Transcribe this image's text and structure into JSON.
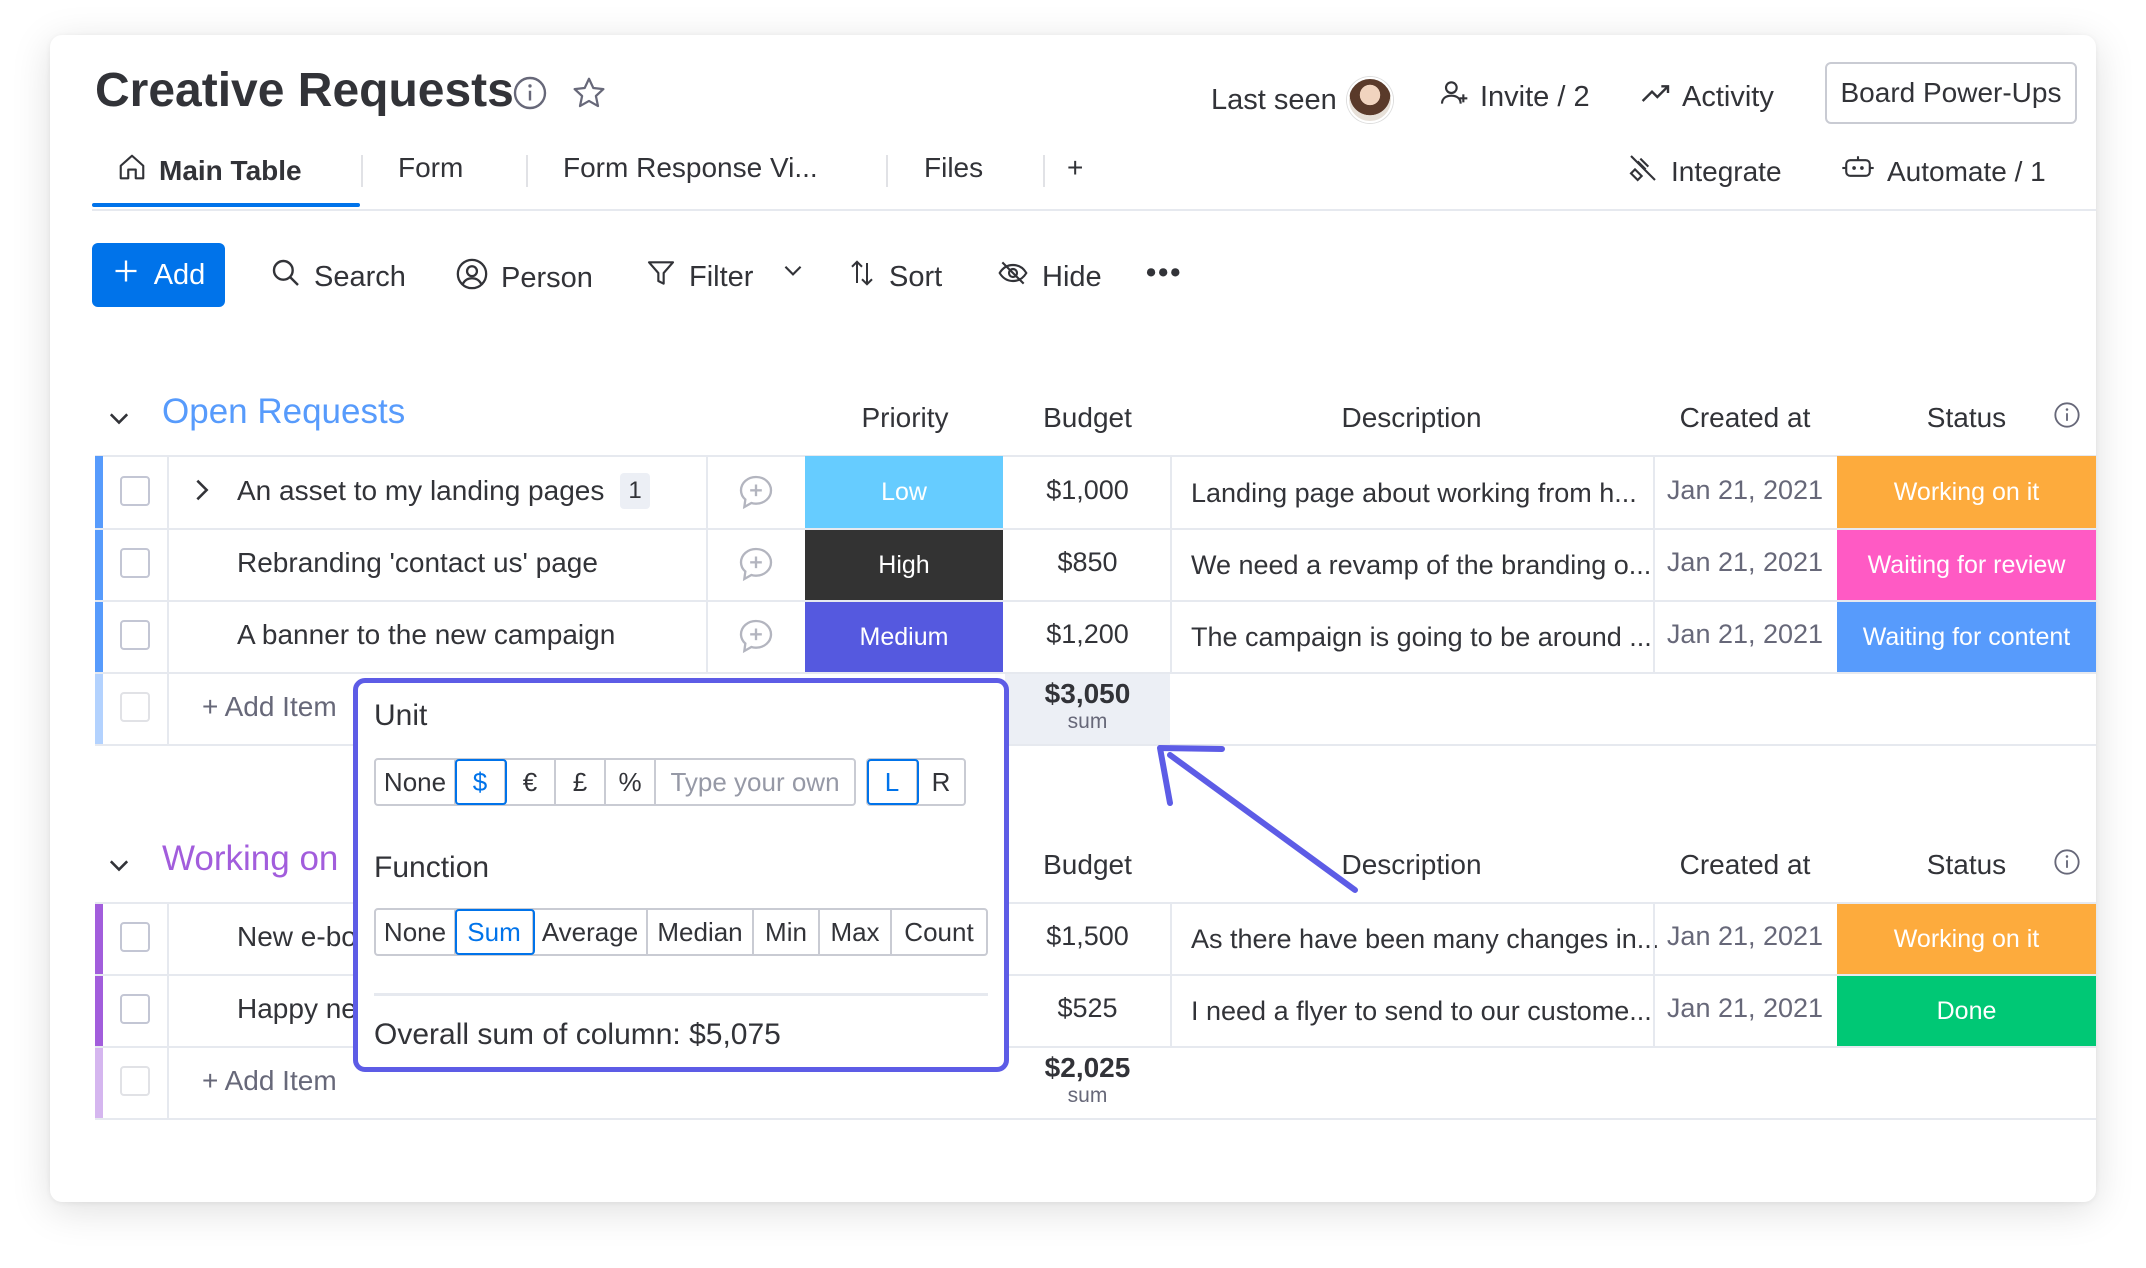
{
  "board": {
    "title": "Creative Requests"
  },
  "header": {
    "last_seen": "Last seen",
    "invite": "Invite / 2",
    "activity": "Activity",
    "power_ups": "Board Power-Ups"
  },
  "tabs": [
    {
      "label": "Main Table",
      "active": true
    },
    {
      "label": "Form"
    },
    {
      "label": "Form Response Vi..."
    },
    {
      "label": "Files"
    },
    {
      "label": "+"
    }
  ],
  "tab_actions": {
    "integrate": "Integrate",
    "automate": "Automate / 1"
  },
  "toolbar": {
    "add": "Add",
    "search": "Search",
    "person": "Person",
    "filter": "Filter",
    "sort": "Sort",
    "hide": "Hide",
    "more": "•••"
  },
  "columns": {
    "priority": "Priority",
    "budget": "Budget",
    "description": "Description",
    "created_at": "Created at",
    "status": "Status"
  },
  "colors": {
    "accent": "#0073ea",
    "group_open": "#579bfc",
    "group_working": "#a25ddc",
    "low": "#66ccff",
    "high": "#333333",
    "medium": "#5559df",
    "working_on_it": "#fdab3d",
    "waiting_for_review": "#ff5ac4",
    "waiting_for_content": "#579bfc",
    "done": "#00c875",
    "popup_border": "#5d5ce6"
  },
  "groups": [
    {
      "title": "Open Requests",
      "items": [
        {
          "name": "An asset to my landing pages",
          "subitems": "1",
          "priority": "Low",
          "budget": "$1,000",
          "description": "Landing page about working from h...",
          "created_at": "Jan 21, 2021",
          "status": "Working on it"
        },
        {
          "name": "Rebranding 'contact us' page",
          "priority": "High",
          "budget": "$850",
          "description": "We need a revamp of the branding o...",
          "created_at": "Jan 21, 2021",
          "status": "Waiting for review"
        },
        {
          "name": "A banner to the new campaign",
          "priority": "Medium",
          "budget": "$1,200",
          "description": "The campaign is going to be around ...",
          "created_at": "Jan 21, 2021",
          "status": "Waiting for content"
        }
      ],
      "add_item": "+ Add Item",
      "sum_value": "$3,050",
      "sum_label": "sum"
    },
    {
      "title": "Working on",
      "items": [
        {
          "name": "New e-bo",
          "budget": "$1,500",
          "description": "As there have been many changes in...",
          "created_at": "Jan 21, 2021",
          "status": "Working on it"
        },
        {
          "name": "Happy ne",
          "budget": "$525",
          "description": "I need a flyer to send to our custome...",
          "created_at": "Jan 21, 2021",
          "status": "Done"
        }
      ],
      "add_item": "+ Add Item",
      "sum_value": "$2,025",
      "sum_label": "sum"
    }
  ],
  "popup": {
    "unit_label": "Unit",
    "units": [
      "None",
      "$",
      "€",
      "£",
      "%"
    ],
    "unit_selected": "$",
    "custom_placeholder": "Type your own",
    "align": [
      "L",
      "R"
    ],
    "align_selected": "L",
    "function_label": "Function",
    "functions": [
      "None",
      "Sum",
      "Average",
      "Median",
      "Min",
      "Max",
      "Count"
    ],
    "function_selected": "Sum",
    "overall": "Overall sum of column: $5,075"
  }
}
